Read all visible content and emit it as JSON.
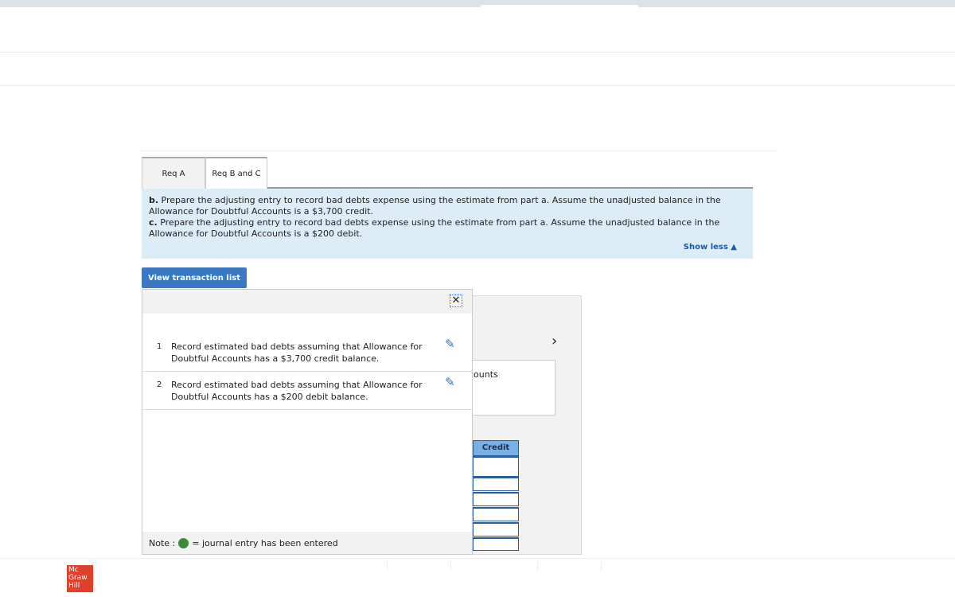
{
  "tabs": [
    {
      "label": "Req A",
      "active": false
    },
    {
      "label": "Req B and C",
      "active": true
    }
  ],
  "instructions": {
    "b_label": "b.",
    "b_text": " Prepare the adjusting entry to record bad debts expense using the estimate from part a. Assume the unadjusted balance in the Allowance for Doubtful Accounts is a $3,700 credit.",
    "c_label": "c.",
    "c_text": " Prepare the adjusting entry to record bad debts expense using the estimate from part a. Assume the unadjusted balance in the Allowance for Doubtful Accounts is a $200 debit.",
    "show_less": "Show less ▲"
  },
  "view_transaction_list": "View transaction list",
  "transaction_list": {
    "close_icon": "✕",
    "items": [
      {
        "number": "1",
        "text": "Record estimated bad debts assuming that Allowance for Doubtful Accounts has a $3,700 credit balance."
      },
      {
        "number": "2",
        "text": "Record estimated bad debts assuming that Allowance for Doubtful Accounts has a $200 debit balance."
      }
    ],
    "note_label": "Note :",
    "note_text": "= journal entry has been entered",
    "note_dot_color": "#3e8a3a"
  },
  "background": {
    "account_partial": "counts",
    "credit_header": "Credit",
    "next_icon": "›"
  },
  "logo": {
    "text": "Mc Graw Hill",
    "color": "#e0412c"
  }
}
